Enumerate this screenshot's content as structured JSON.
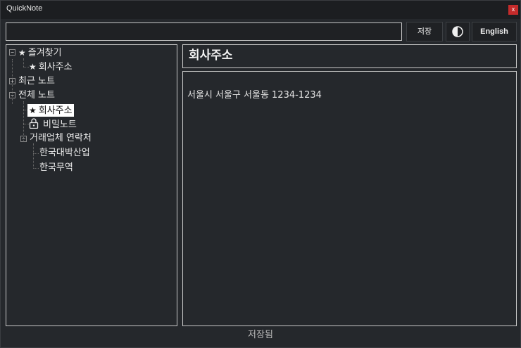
{
  "window": {
    "title": "QuickNote",
    "close_label": "x"
  },
  "toolbar": {
    "title_value": "",
    "save_label": "저장",
    "lang_label": "English"
  },
  "tree": {
    "favorites": {
      "label": "즐겨찾기",
      "expanded": true,
      "children": [
        "회사주소"
      ]
    },
    "recent": {
      "label": "최근 노트",
      "expanded": false
    },
    "all_notes": {
      "label": "전체 노트",
      "expanded": true,
      "children": {
        "company_address": "회사주소",
        "secret_note": "비밀노트",
        "vendor_contacts": {
          "label": "거래업체 연락처",
          "expanded": true,
          "children": [
            "한국대박산업",
            "한국무역"
          ]
        }
      }
    }
  },
  "note": {
    "title": "회사주소",
    "body": "서울시 서울구 서울동 1234-1234"
  },
  "status": {
    "text": "저장됨"
  }
}
